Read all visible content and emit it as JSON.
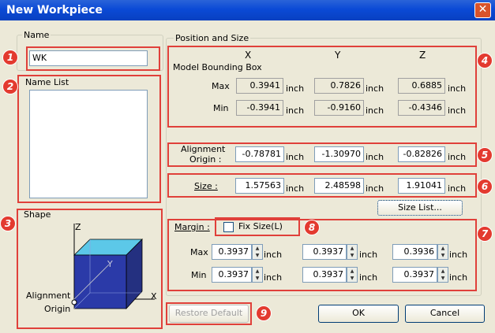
{
  "window": {
    "title": "New Workpiece",
    "close_glyph": "✕"
  },
  "name_group": {
    "label": "Name",
    "value": "WK"
  },
  "name_list": {
    "label": "Name List"
  },
  "shape_group": {
    "label": "Shape",
    "axis_z": "Z",
    "axis_y": "Y",
    "axis_x": "X",
    "origin_label_line1": "Alignment",
    "origin_label_line2": "Origin"
  },
  "position_group": {
    "label": "Position and Size"
  },
  "bbox": {
    "title": "Model Bounding Box",
    "col_x": "X",
    "col_y": "Y",
    "col_z": "Z",
    "max_label": "Max",
    "min_label": "Min",
    "max": [
      "0.3941",
      "0.7826",
      "0.6885"
    ],
    "min": [
      "-0.3941",
      "-0.9160",
      "-0.4346"
    ]
  },
  "unit": "inch",
  "alignment": {
    "label_line1": "Alignment",
    "label_line2": "Origin :",
    "values": [
      "-0.78781",
      "-1.30970",
      "-0.82826"
    ]
  },
  "size": {
    "label": "Size :",
    "values": [
      "1.57563",
      "2.48598",
      "1.91041"
    ],
    "list_button": "Size List..."
  },
  "margin": {
    "label": "Margin :",
    "fix_size_label": "Fix Size(L)",
    "fix_size_checked": false,
    "max_label": "Max",
    "min_label": "Min",
    "max": [
      "0.3937",
      "0.3937",
      "0.3936"
    ],
    "min": [
      "0.3937",
      "0.3937",
      "0.3937"
    ]
  },
  "buttons": {
    "restore_default": "Restore Default",
    "ok": "OK",
    "cancel": "Cancel"
  },
  "badges": [
    "1",
    "2",
    "3",
    "4",
    "5",
    "6",
    "7",
    "8",
    "9"
  ],
  "colors": {
    "highlight": "#e0403a",
    "titlebar": "#0b4ad6",
    "cube_front": "#2b3aa8",
    "cube_top": "#5cc8e8"
  }
}
